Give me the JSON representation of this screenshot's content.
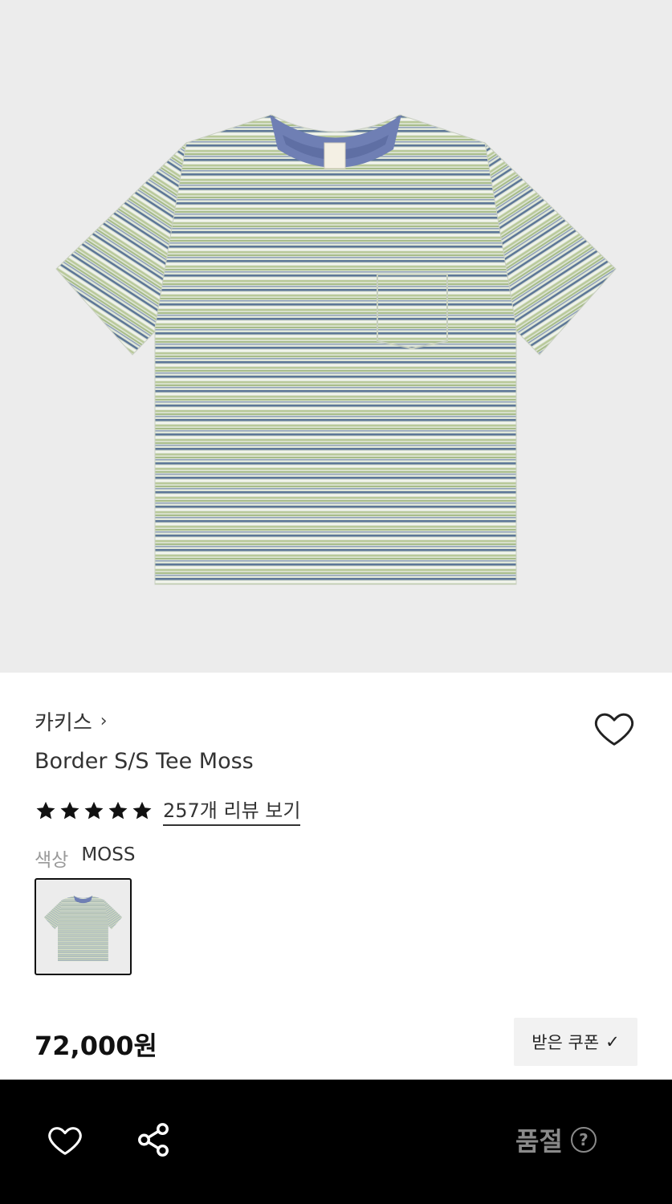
{
  "product": {
    "brand": "카키스",
    "brand_chevron": "›",
    "title": "Border S/S Tee Moss",
    "rating": 5,
    "review_link": "257개 리뷰 보기",
    "color_label": "색상",
    "color_value": "MOSS",
    "price": "72,000원"
  },
  "coupon": {
    "label": "받은 쿠폰",
    "check": "✓"
  },
  "bottom_bar": {
    "status": "품절",
    "help": "?"
  },
  "colors": {
    "stripe_blue": "#5d7797",
    "stripe_green": "#b9c99a",
    "shirt_base": "#dfe6d8",
    "collar": "#6f7fb4",
    "hero_bg": "#ececec"
  }
}
